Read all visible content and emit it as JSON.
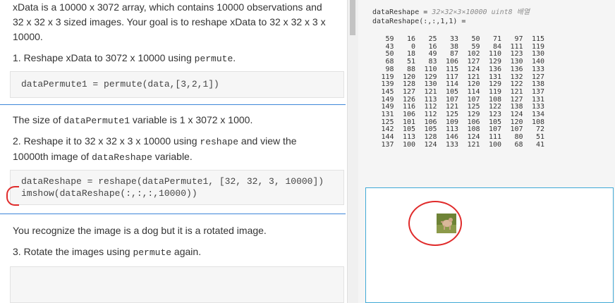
{
  "left": {
    "intro": {
      "line1": "xData is a 10000 x 3072 array, which contains 10000 observations and",
      "line2": "32 x 32 x 3 sized images. Your goal is to reshape xData to 32 x 32 x 3 x",
      "line3": "10000."
    },
    "step1": {
      "text": "1. Reshape xData to 3072 x 10000 using ",
      "code": "permute",
      "end": "."
    },
    "code1": "dataPermute1 = permute(data,[3,2,1])",
    "size_note": {
      "pre": "The size of ",
      "code": "dataPermute1",
      "post": " variable is 1 x 3072 x 1000."
    },
    "step2": {
      "line1_pre": "2. Reshape it to 32 x 32 x 3 x 10000 using ",
      "line1_code": "reshape",
      "line1_post": " and view the",
      "line2_pre": "10000th image of ",
      "line2_code": "dataReshape",
      "line2_post": " variable."
    },
    "code2": {
      "line1": "dataReshape = reshape(dataPermute1, [32, 32, 3, 10000])",
      "line2": "imshow(dataReshape(:,:,:,10000))"
    },
    "observation": "You recognize the image is a dog but it is a rotated image.",
    "step3": {
      "text": "3. Rotate the images using ",
      "code": "permute",
      "end": " again."
    }
  },
  "right": {
    "output_line1_name": "dataReshape = ",
    "output_line1_meta": "32×32×3×10000 uint8 배열",
    "output_line2": "dataReshape(:,:,1,1) =",
    "matrix": [
      [
        59,
        16,
        25,
        33,
        50,
        71,
        97,
        115
      ],
      [
        43,
        0,
        16,
        38,
        59,
        84,
        111,
        119
      ],
      [
        50,
        18,
        49,
        87,
        102,
        110,
        123,
        130
      ],
      [
        68,
        51,
        83,
        106,
        127,
        129,
        130,
        140
      ],
      [
        98,
        88,
        110,
        115,
        124,
        136,
        136,
        133
      ],
      [
        119,
        120,
        129,
        117,
        121,
        131,
        132,
        127
      ],
      [
        139,
        128,
        130,
        114,
        120,
        129,
        122,
        138
      ],
      [
        145,
        127,
        121,
        105,
        114,
        119,
        121,
        137
      ],
      [
        149,
        126,
        113,
        107,
        107,
        108,
        127,
        131
      ],
      [
        149,
        116,
        112,
        121,
        125,
        122,
        138,
        133
      ],
      [
        131,
        106,
        112,
        125,
        129,
        123,
        124,
        134
      ],
      [
        125,
        101,
        106,
        109,
        106,
        105,
        120,
        108
      ],
      [
        142,
        105,
        105,
        113,
        108,
        107,
        107,
        72
      ],
      [
        144,
        113,
        128,
        146,
        124,
        111,
        80,
        51
      ],
      [
        137,
        100,
        124,
        133,
        121,
        100,
        68,
        41
      ]
    ]
  }
}
